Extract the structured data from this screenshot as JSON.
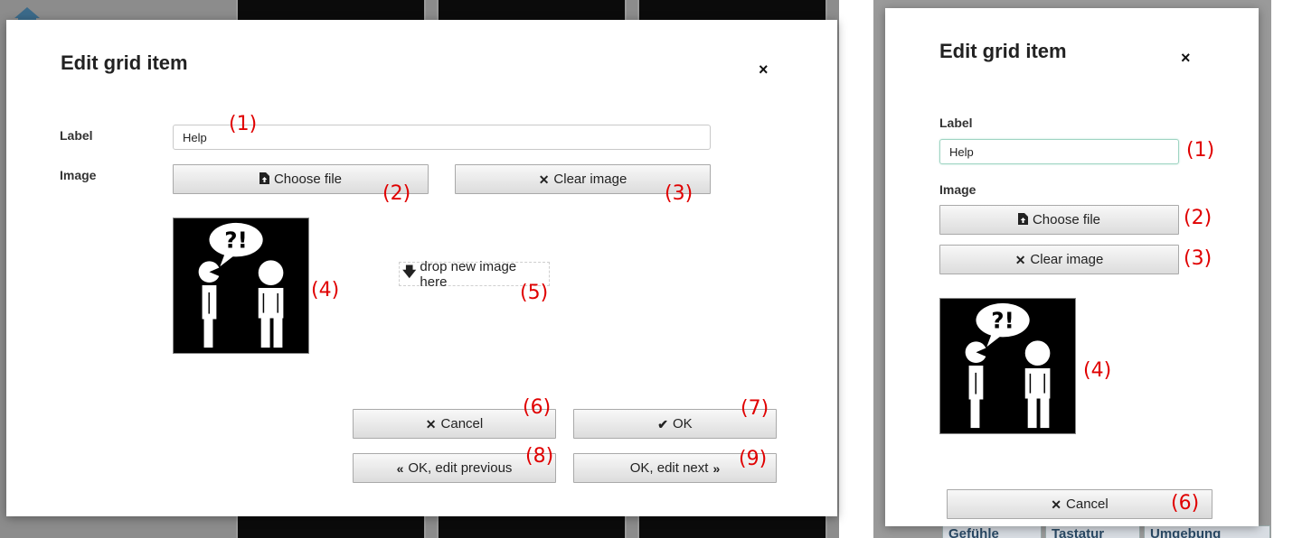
{
  "left_dialog": {
    "title": "Edit grid item",
    "close_symbol": "×",
    "label_caption": "Label",
    "label_value": "Help",
    "image_caption": "Image",
    "choose_file_label": "Choose file",
    "clear_image_label": "Clear image",
    "drop_zone_label": "drop new image here",
    "cancel_label": "Cancel",
    "ok_label": "OK",
    "ok_prev_label": "OK, edit previous",
    "ok_next_label": "OK, edit next"
  },
  "right_dialog": {
    "title": "Edit grid item",
    "close_symbol": "×",
    "label_caption": "Label",
    "label_value": "Help",
    "image_caption": "Image",
    "choose_file_label": "Choose file",
    "clear_image_label": "Clear image",
    "cancel_label": "Cancel"
  },
  "pictogram": {
    "speech_text": "?!",
    "icon": "help-pictogram"
  },
  "annotations": {
    "a1": "(1)",
    "a2": "(2)",
    "a3": "(3)",
    "a4": "(4)",
    "a5": "(5)",
    "a6": "(6)",
    "a7": "(7)",
    "a8": "(8)",
    "a9": "(9)"
  },
  "background_right": {
    "btn1": "Gefühle",
    "btn2": "Tastatur",
    "btn3": "Umgebung"
  },
  "colors": {
    "annotation": "#e00000",
    "overlay": "#8c8c8c"
  }
}
